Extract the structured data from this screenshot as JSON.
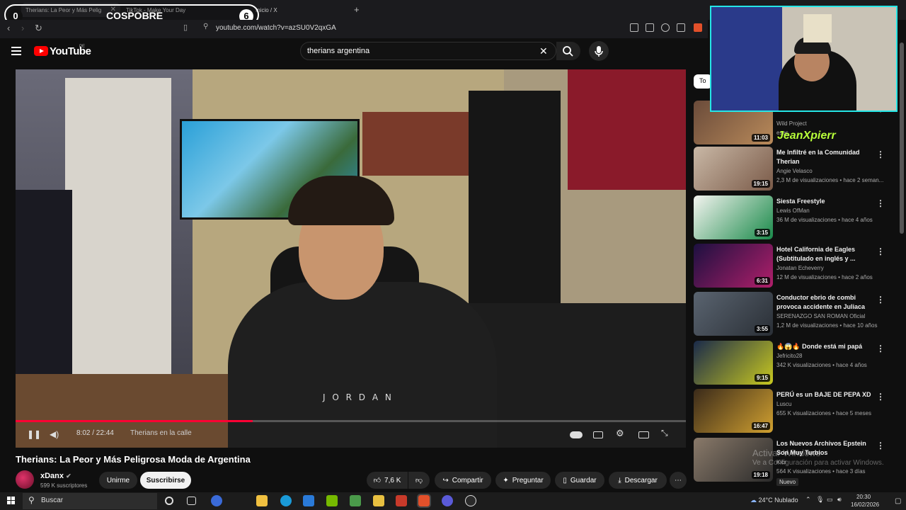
{
  "browser": {
    "tabs": [
      {
        "label": "Therians: La Peor y Más Pelig"
      },
      {
        "label": "TikTok - Make Your Day"
      },
      {
        "label": "Inicio / X"
      }
    ],
    "url": "youtube.com/watch?v=azSU0V2qxGA"
  },
  "overlay": {
    "left_count": "0",
    "title": "COSPOBRE",
    "right_count": "6"
  },
  "youtube": {
    "logo_text": "YouTube",
    "country": "PE",
    "search_value": "therians argentina"
  },
  "player": {
    "time": "8:02 / 22:44",
    "chapter": "Therians en la calle",
    "progress_fraction": 0.354
  },
  "video": {
    "title": "Therians: La Peor y Más Peligrosa Moda de Argentina",
    "channel": "xDanx",
    "subscribers": "599 K suscriptores",
    "join_label": "Unirme",
    "subscribe_label": "Suscribirse",
    "likes": "7,6 K",
    "share_label": "Compartir",
    "ask_label": "Preguntar",
    "save_label": "Guardar",
    "download_label": "Descargar"
  },
  "sidebar": {
    "chip": "To",
    "items": [
      {
        "title": "",
        "channel": "Wild Project",
        "meta": "eses",
        "duration": "11:03",
        "colors": [
          "#6a4b3a",
          "#b98a5a"
        ]
      },
      {
        "title": "Me Infiltré en la Comunidad Therian",
        "channel": "Angie Velasco",
        "meta": "2,3 M de visualizaciones • hace 2 seman...",
        "duration": "19:15",
        "colors": [
          "#c9b8a6",
          "#7a5a48"
        ]
      },
      {
        "title": "Siesta Freestyle",
        "channel": "Lewis OfMan",
        "meta": "36 M de visualizaciones • hace 4 años",
        "duration": "3:15",
        "colors": [
          "#f4f4f0",
          "#1a8a4a"
        ]
      },
      {
        "title": "Hotel California de Eagles (Subtitulado en inglés y ...",
        "channel": "Jonatan Echeverry",
        "meta": "12 M de visualizaciones • hace 2 años",
        "duration": "6:31",
        "colors": [
          "#1c1040",
          "#b01f6a"
        ]
      },
      {
        "title": "Conductor ebrio de combi provoca accidente en Juliaca",
        "channel": "SERENAZGO SAN ROMAN Oficial",
        "meta": "1,2 M de visualizaciones • hace 10 años",
        "duration": "3:55",
        "colors": [
          "#5a6470",
          "#2a2f36"
        ]
      },
      {
        "title": "🔥😱🔥 Donde está mi papá",
        "channel": "Jefricito28",
        "meta": "342 K visualizaciones • hace 4 años",
        "duration": "9:15",
        "colors": [
          "#1a2a4a",
          "#c8c820"
        ]
      },
      {
        "title": "PERÚ es un BAJE DE PEPA XD",
        "channel": "Luscu",
        "meta": "655 K visualizaciones • hace 5 meses",
        "duration": "16:47",
        "colors": [
          "#3a2a1a",
          "#d0a030"
        ]
      },
      {
        "title": "Los Nuevos Archivos Epstein Son Muy Turbios",
        "channel": "Kicr",
        "meta": "564 K visualizaciones • hace 3 días",
        "duration": "19:18",
        "colors": [
          "#8a7a6a",
          "#2a2a2a"
        ],
        "badge": "Nuevo"
      }
    ]
  },
  "webcam": {
    "streamer": "JeanXpierr"
  },
  "watermark": {
    "line1": "Activar Windows",
    "line2": "Ve a Configuración para activar Windows."
  },
  "taskbar": {
    "search_placeholder": "Buscar",
    "weather": "24°C  Nublado",
    "time": "20:30",
    "date": "16/02/2026"
  }
}
